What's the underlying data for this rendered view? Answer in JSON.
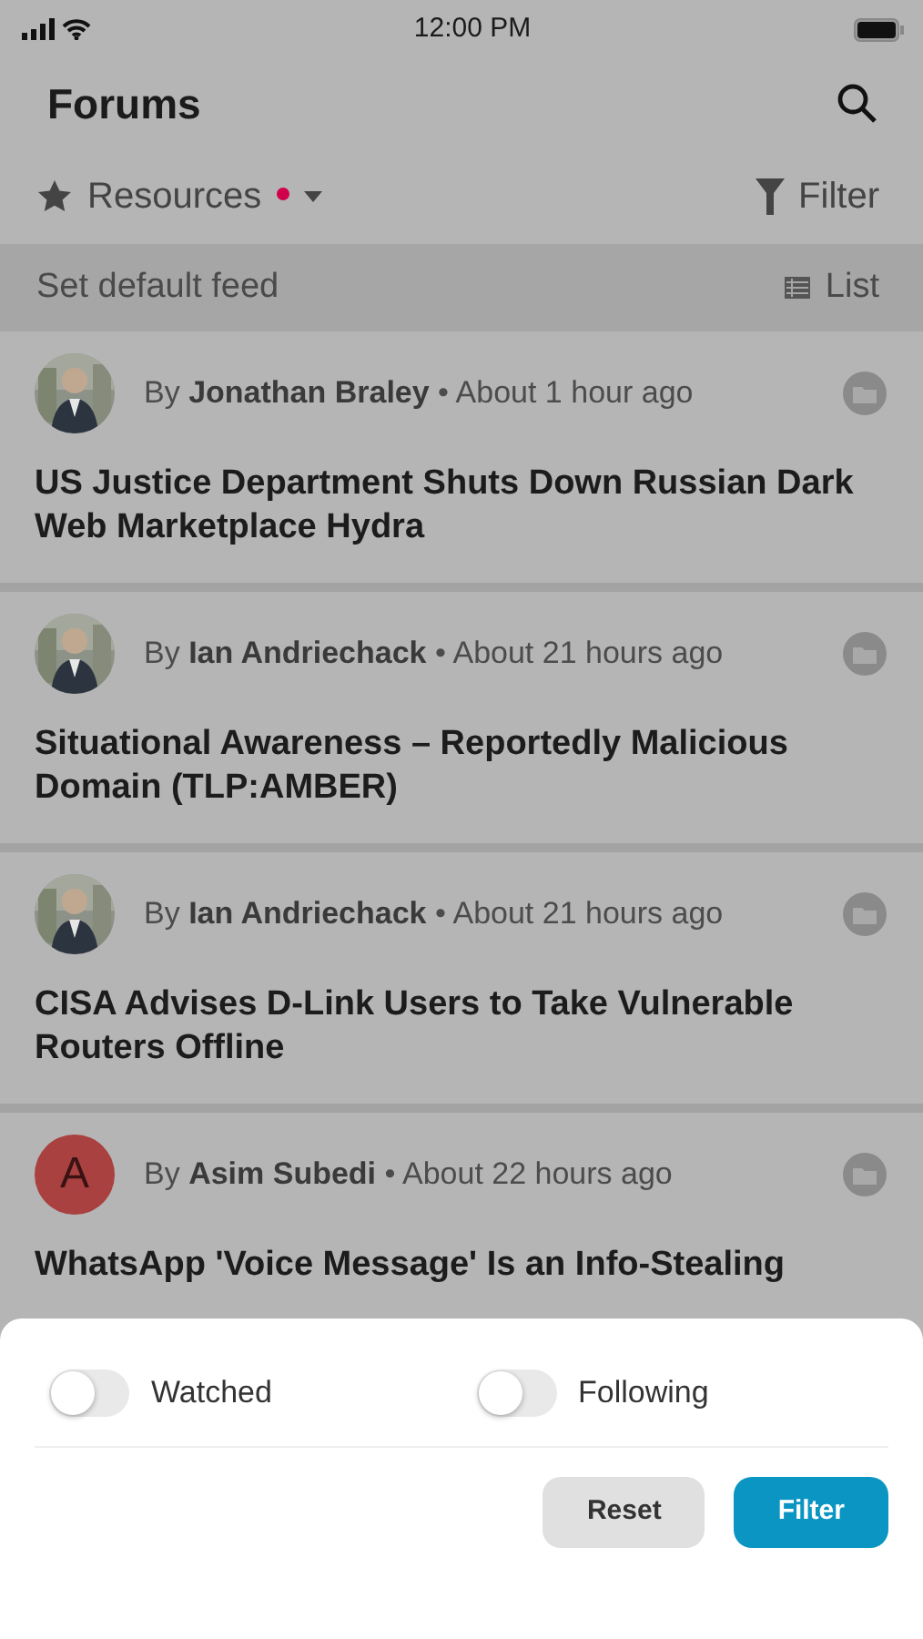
{
  "status_bar": {
    "time": "12:00 PM"
  },
  "header": {
    "title": "Forums"
  },
  "toolbar": {
    "feed_label": "Resources",
    "unread_dot": true,
    "filter_label": "Filter"
  },
  "feed_bar": {
    "label": "Set default feed",
    "view_label": "List"
  },
  "posts": [
    {
      "by": "By",
      "author": "Jonathan Braley",
      "sep": "•",
      "time": "About 1 hour ago",
      "title": "US Justice Department Shuts Down Russian Dark Web Marketplace Hydra"
    },
    {
      "by": "By",
      "author": "Ian Andriechack",
      "sep": "•",
      "time": "About 21 hours ago",
      "title": "Situational Awareness – Reportedly Malicious Domain (TLP:AMBER)"
    },
    {
      "by": "By",
      "author": "Ian Andriechack",
      "sep": "•",
      "time": "About 21 hours ago",
      "title": "CISA Advises D-Link Users to Take Vulnerable Routers Offline"
    },
    {
      "avatar": {
        "kind": "initial",
        "text": "A",
        "color": "#a8413f"
      },
      "by": "By",
      "author": "Asim Subedi",
      "sep": "•",
      "time": "About 22 hours ago",
      "title": "WhatsApp 'Voice Message' Is an Info-Stealing"
    }
  ],
  "filter_sheet": {
    "toggles": [
      {
        "label": "Watched",
        "on": false
      },
      {
        "label": "Following",
        "on": false
      }
    ],
    "buttons": [
      {
        "kind": "secondary",
        "label": "Reset"
      },
      {
        "kind": "primary",
        "label": "Filter"
      }
    ]
  }
}
